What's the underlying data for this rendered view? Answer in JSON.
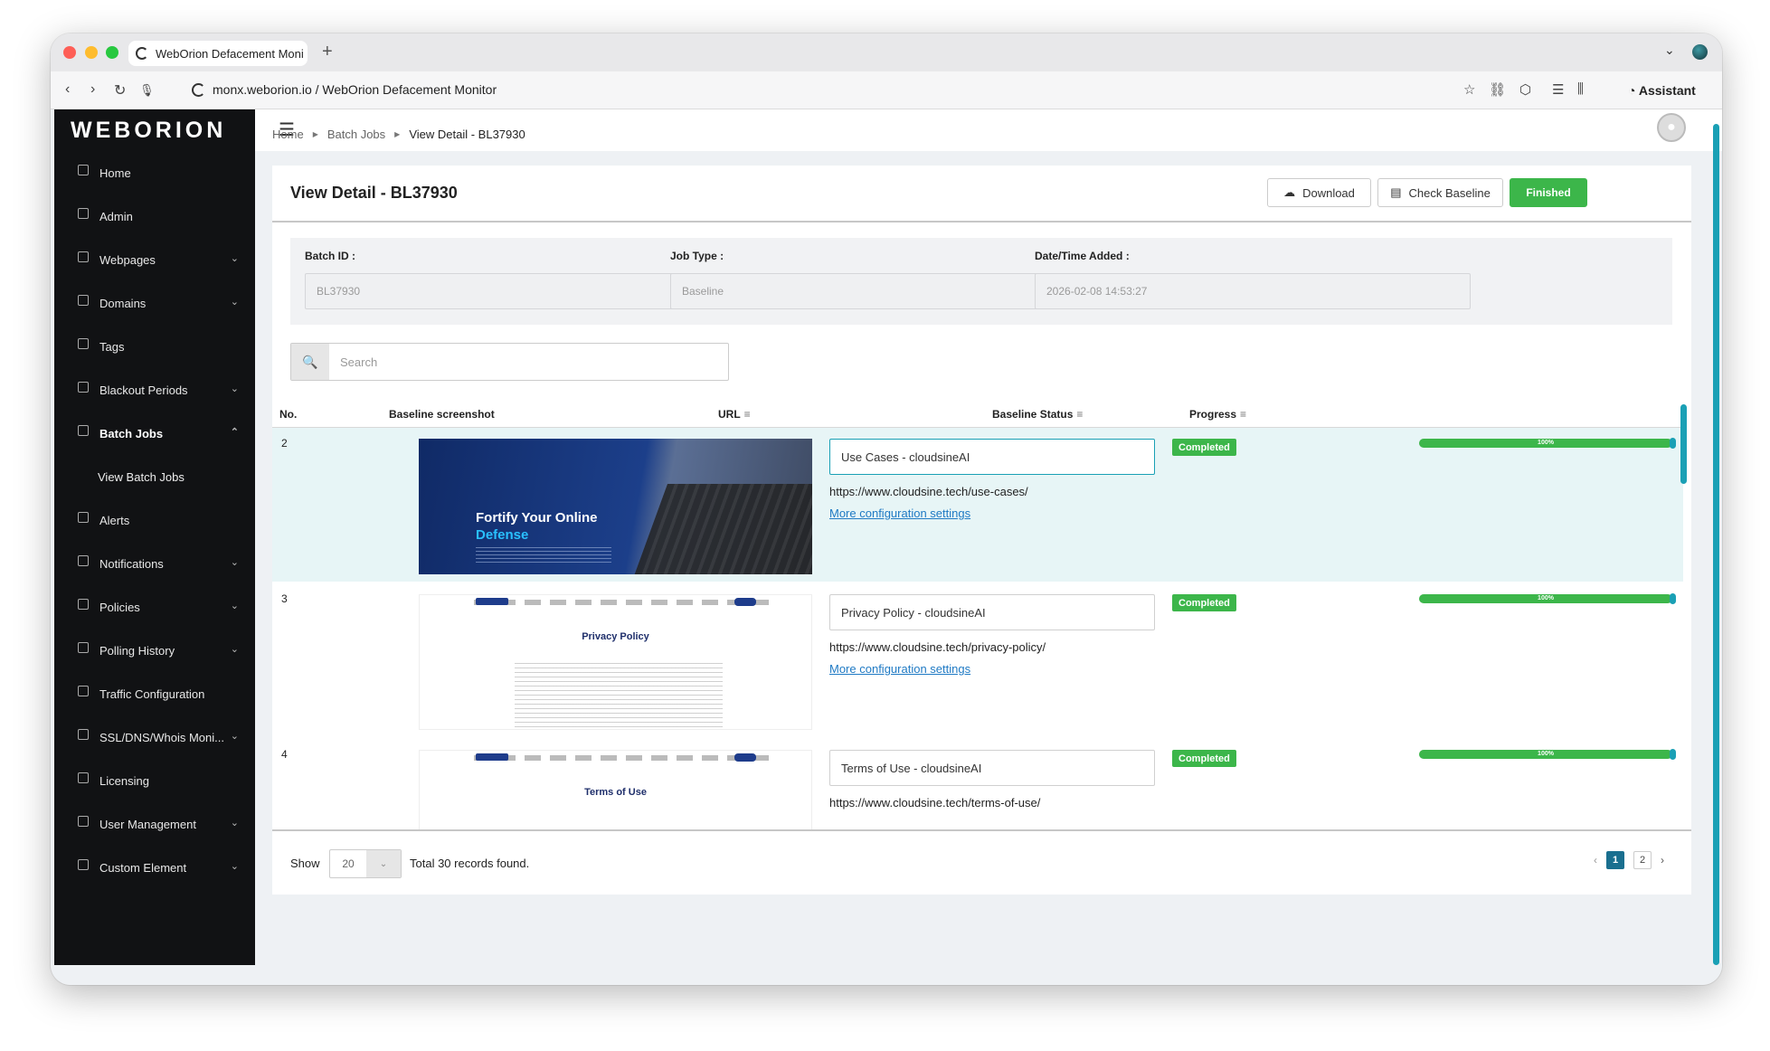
{
  "browser": {
    "tab_title": "WebOrion Defacement Moni",
    "address": "monx.weborion.io / WebOrion Defacement Monitor",
    "assistant_label": "Assistant"
  },
  "sidebar": {
    "logo": "WEBORION",
    "items": [
      {
        "label": "Home",
        "has_chevron": false
      },
      {
        "label": "Admin",
        "has_chevron": false
      },
      {
        "label": "Webpages",
        "has_chevron": true
      },
      {
        "label": "Domains",
        "has_chevron": true
      },
      {
        "label": "Tags",
        "has_chevron": false
      },
      {
        "label": "Blackout Periods",
        "has_chevron": true
      },
      {
        "label": "Batch Jobs",
        "has_chevron": true,
        "expanded": true
      },
      {
        "label": "Alerts",
        "has_chevron": false
      },
      {
        "label": "Notifications",
        "has_chevron": true
      },
      {
        "label": "Policies",
        "has_chevron": true
      },
      {
        "label": "Polling History",
        "has_chevron": true
      },
      {
        "label": "Traffic Configuration",
        "has_chevron": false
      },
      {
        "label": "SSL/DNS/Whois Moni...",
        "has_chevron": true
      },
      {
        "label": "Licensing",
        "has_chevron": false
      },
      {
        "label": "User Management",
        "has_chevron": true
      },
      {
        "label": "Custom Element",
        "has_chevron": true
      }
    ],
    "submenu_label": "View Batch Jobs"
  },
  "breadcrumb": {
    "home": "Home",
    "batch_jobs": "Batch Jobs",
    "current": "View Detail - BL37930"
  },
  "page": {
    "title": "View Detail - BL37930",
    "download_label": "Download",
    "check_baseline_label": "Check Baseline",
    "finished_label": "Finished",
    "batch_id_label": "Batch ID :",
    "batch_id_value": "BL37930",
    "job_type_label": "Job Type :",
    "job_type_value": "Baseline",
    "datetime_label": "Date/Time Added :",
    "datetime_value": "2026-02-08 14:53:27",
    "search_placeholder": "Search"
  },
  "table": {
    "headers": {
      "no": "No.",
      "screenshot": "Baseline screenshot",
      "url": "URL",
      "status": "Baseline Status",
      "progress": "Progress"
    },
    "more_label": "More configuration settings",
    "rows": [
      {
        "no": "2",
        "title": "Use Cases - cloudsineAI",
        "url": "https://www.cloudsine.tech/use-cases/",
        "status": "Completed",
        "progress": 100,
        "progress_label": "100%",
        "shot_heading": "Fortify Your Online",
        "shot_subheading": "Defense"
      },
      {
        "no": "3",
        "title": "Privacy Policy - cloudsineAI",
        "url": "https://www.cloudsine.tech/privacy-policy/",
        "status": "Completed",
        "progress": 100,
        "progress_label": "100%",
        "shot_heading": "Privacy Policy"
      },
      {
        "no": "4",
        "title": "Terms of Use - cloudsineAI",
        "url": "https://www.cloudsine.tech/terms-of-use/",
        "status": "Completed",
        "progress": 100,
        "progress_label": "100%",
        "shot_heading": "Terms of Use"
      }
    ]
  },
  "footer": {
    "show_label": "Show",
    "page_size": "20",
    "total_text": "Total 30 records found.",
    "pages": [
      "1",
      "2"
    ],
    "current_page": "1"
  },
  "colors": {
    "accent": "#1aa0b5",
    "success": "#3cb64a",
    "sidebar_bg": "#111214",
    "link": "#1f7ac4"
  }
}
